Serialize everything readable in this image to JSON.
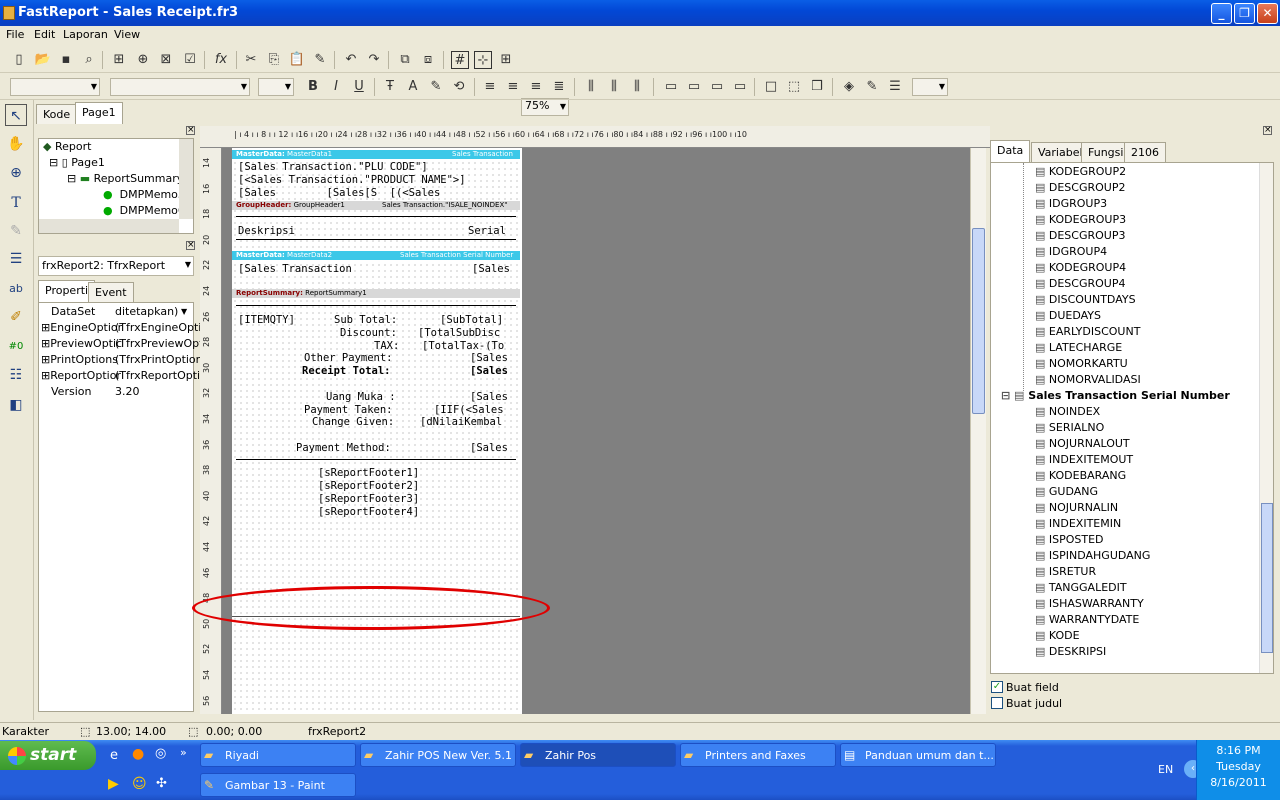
{
  "window": {
    "title": "FastReport - Sales Receipt.fr3"
  },
  "menu": [
    "File",
    "Edit",
    "Laporan",
    "View"
  ],
  "toolbar": {
    "zoom": "75%"
  },
  "designer_tabs": [
    "Kode",
    "Page1"
  ],
  "tree": {
    "items": [
      "Report",
      "Page1",
      "ReportSummary",
      "DMPMemo5",
      "DMPMemo6"
    ]
  },
  "object_selector": "frxReport2: TfrxReport",
  "inspector": {
    "tabs": [
      "Properti",
      "Event"
    ],
    "rows": [
      {
        "name": "DataSet",
        "value": "ditetapkan)"
      },
      {
        "name": "EngineOptior",
        "value": "(TfrxEngineOptic"
      },
      {
        "name": "PreviewOptic",
        "value": "(TfrxPreviewOpt"
      },
      {
        "name": "PrintOptions",
        "value": "(TfrxPrintOption"
      },
      {
        "name": "ReportOptior",
        "value": "(TfrxReportOpti"
      },
      {
        "name": "Version",
        "value": "3.20"
      }
    ]
  },
  "hruler": "| ı 4 ı ı 8 ı ı 12 ı ı16 ı ı20 ı ı24 ı ı28 ı ı32 ı ı36 ı ı40 ı ı44 ı ı48 ı ı52 ı ı56 ı ı60 ı ı64 ı ı68 ı ı72 ı ı76 ı ı80 ı ı84 ı ı88 ı ı92 ı ı96 ı ı100 ı ı10",
  "vruler": [
    "14",
    "16",
    "18",
    "20",
    "22",
    "24",
    "26",
    "28",
    "30",
    "32",
    "34",
    "36",
    "38",
    "40",
    "42",
    "44",
    "46",
    "48",
    "50",
    "52",
    "54",
    "56"
  ],
  "bands": {
    "md1_label": "MasterData:",
    "md1_name": "MasterData1",
    "md1_ds": "Sales Transaction",
    "gh_label": "GroupHeader:",
    "gh_name": "GroupHeader1",
    "gh_ds": "Sales Transaction.\"ISALE_NOINDEX\"",
    "md2_label": "MasterData:",
    "md2_name": "MasterData2",
    "md2_ds": "Sales Transaction Serial Number",
    "rs_label": "ReportSummary:",
    "rs_name": "ReportSummary1"
  },
  "report_text": {
    "l1": "[Sales Transaction.\"PLU CODE\"]",
    "l2": "[<Sales Transaction.\"PRODUCT NAME\">]",
    "l3": "[Sales        [Sales[S  [(<Sales",
    "deskripsi": "Deskripsi",
    "serial": "Serial",
    "l4": "[Sales Transaction",
    "l4b": "[Sales",
    "itemqty": "[ITEMQTY]",
    "subtotal_lbl": "Sub Total:",
    "subtotal_val": "[SubTotal]",
    "discount_lbl": "Discount:",
    "discount_val": "[TotalSubDisc",
    "tax_lbl": "TAX:",
    "tax_val": "[TotalTax-(To",
    "otherpay_lbl": "Other Payment:",
    "otherpay_val": "[Sales",
    "receipt_lbl": "Receipt Total:",
    "receipt_val": "[Sales",
    "uangmuka_lbl": "Uang Muka :",
    "uangmuka_val": "[Sales",
    "paytaken_lbl": "Payment Taken:",
    "paytaken_val": "[IIF(<Sales",
    "change_lbl": "Change Given:",
    "change_val": "[dNilaiKembal",
    "paymethod_lbl": "Payment Method:",
    "paymethod_val": "[Sales",
    "f1": "[sReportFooter1]",
    "f2": "[sReportFooter2]",
    "f3": "[sReportFooter3]",
    "f4": "[sReportFooter4]"
  },
  "data_tabs": [
    "Data",
    "Variabel",
    "Fungsi",
    "2106"
  ],
  "data_fields_top": [
    "KODEGROUP2",
    "DESCGROUP2",
    "IDGROUP3",
    "KODEGROUP3",
    "DESCGROUP3",
    "IDGROUP4",
    "KODEGROUP4",
    "DESCGROUP4",
    "DISCOUNTDAYS",
    "DUEDAYS",
    "EARLYDISCOUNT",
    "LATECHARGE",
    "NOMORKARTU",
    "NOMORVALIDASI"
  ],
  "dataset_title": "Sales Transaction Serial Number",
  "data_fields": [
    "NOINDEX",
    "SERIALNO",
    "NOJURNALOUT",
    "INDEXITEMOUT",
    "KODEBARANG",
    "GUDANG",
    "NOJURNALIN",
    "INDEXITEMIN",
    "ISPOSTED",
    "ISPINDAHGUDANG",
    "ISRETUR",
    "TANGGALEDIT",
    "ISHASWARRANTY",
    "WARRANTYDATE",
    "KODE",
    "DESKRIPSI"
  ],
  "checkboxes": [
    {
      "label": "Buat field",
      "checked": true
    },
    {
      "label": "Buat judul",
      "checked": false
    }
  ],
  "status": {
    "mode": "Karakter",
    "pos": "13.00; 14.00",
    "size": "0.00; 0.00",
    "obj": "frxReport2"
  },
  "taskbar": {
    "start": "start",
    "tasks": [
      "Riyadi",
      "Zahir POS New Ver. 5.1",
      "Zahir Pos",
      "Printers and Faxes",
      "Panduan umum dan t...",
      "Gambar 13 - Paint"
    ],
    "lang": "EN",
    "time": "8:16 PM",
    "day": "Tuesday",
    "date": "8/16/2011"
  }
}
